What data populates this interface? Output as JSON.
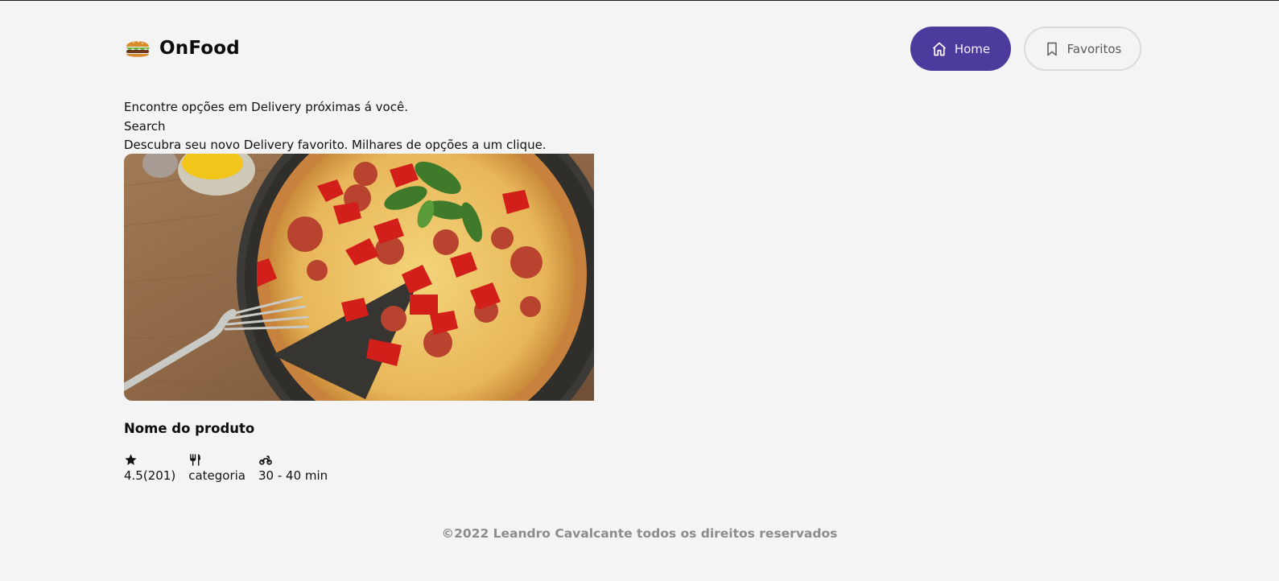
{
  "brand": {
    "name": "OnFood",
    "logo_icon": "burger-icon"
  },
  "nav": {
    "home": {
      "label": "Home",
      "icon": "home-icon",
      "active": true,
      "color": "#4c3a9c"
    },
    "favorites": {
      "label": "Favoritos",
      "icon": "bookmark-icon",
      "active": false
    }
  },
  "intro": {
    "headline": "Encontre opções em Delivery próximas á você.",
    "search_label": "Search",
    "tagline": "Descubra seu novo Delivery favorito. Milhares de opções a um clique."
  },
  "product": {
    "image_icon": "pizza-photo",
    "name": "Nome do produto",
    "rating": "4.5(201)",
    "rating_icon": "star-icon",
    "category": "categoria",
    "category_icon": "utensils-icon",
    "delivery_time": "30 - 40 min",
    "delivery_icon": "motorcycle-icon"
  },
  "footer": {
    "text": "©2022 Leandro Cavalcante todos os direitos reservados"
  }
}
